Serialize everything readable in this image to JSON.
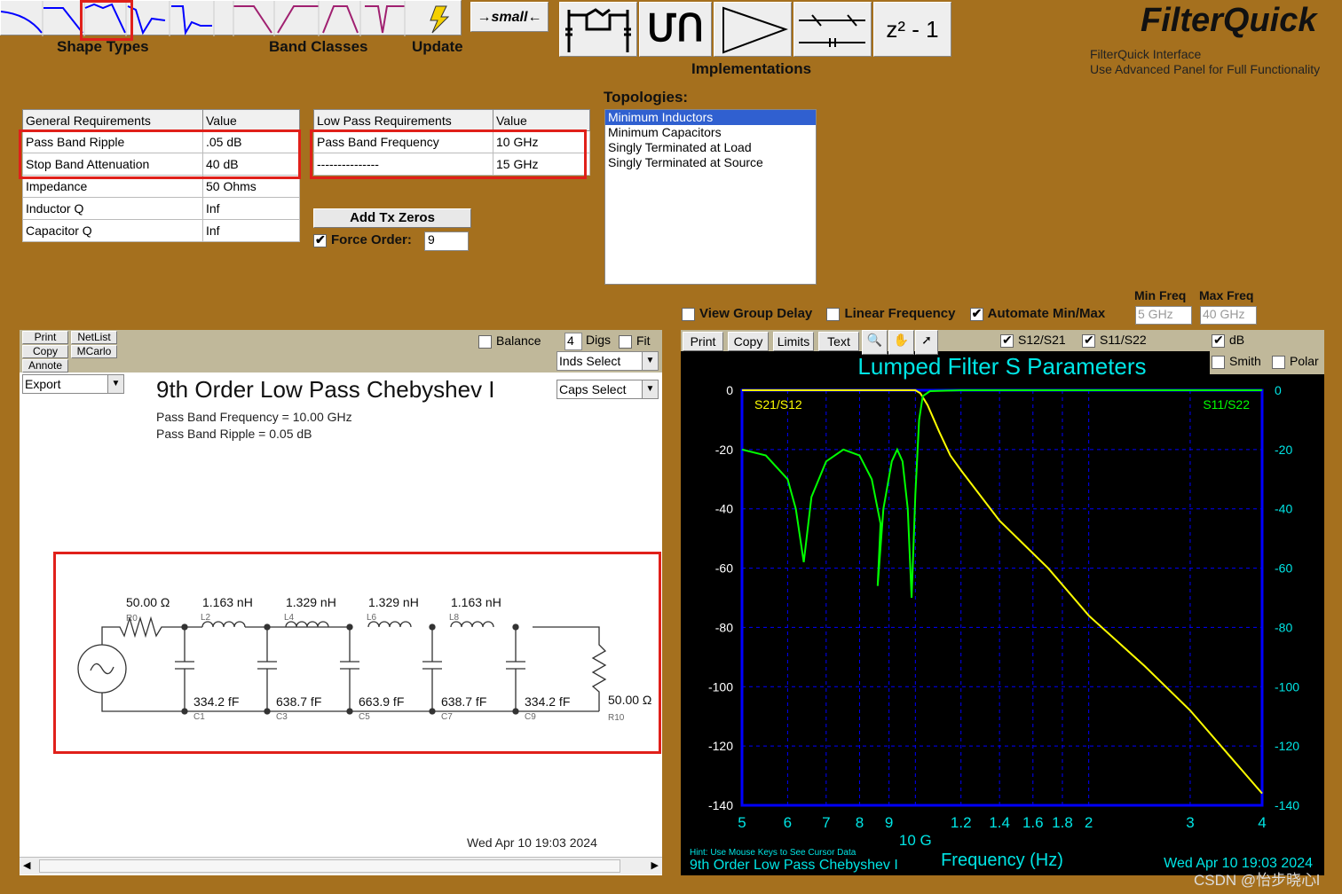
{
  "toolbar": {
    "shape_types_label": "Shape Types",
    "band_classes_label": "Band Classes",
    "update_label": "Update",
    "small_label": "small",
    "implementations_label": "Implementations",
    "z_label": "z² - 1"
  },
  "brand": {
    "title": "FilterQuick",
    "line1": "FilterQuick Interface",
    "line2": "Use Advanced Panel for Full  Functionality"
  },
  "general": {
    "headers": [
      "General Requirements",
      "Value"
    ],
    "rows": [
      [
        "Pass Band Ripple",
        ".05 dB"
      ],
      [
        "Stop Band Attenuation",
        "40 dB"
      ],
      [
        "Impedance",
        "50 Ohms"
      ],
      [
        "Inductor Q",
        "Inf"
      ],
      [
        "Capacitor Q",
        "Inf"
      ]
    ]
  },
  "lowpass": {
    "headers": [
      "Low Pass Requirements",
      "Value"
    ],
    "rows": [
      [
        "Pass Band Frequency",
        "10 GHz"
      ],
      [
        "---------------",
        "15 GHz"
      ]
    ]
  },
  "add_tx_zeros": "Add Tx Zeros",
  "force_order_label": "Force Order:",
  "force_order_value": "9",
  "force_order_checked": true,
  "topologies": {
    "label": "Topologies:",
    "items": [
      "Minimum Inductors",
      "Minimum Capacitors",
      "Singly Terminated at Load",
      "Singly Terminated at Source"
    ],
    "selected": 0
  },
  "options": {
    "view_group_delay": "View Group Delay",
    "linear_frequency": "Linear Frequency",
    "automate": "Automate Min/Max",
    "min_freq_label": "Min Freq",
    "max_freq_label": "Max Freq",
    "min_freq": "5 GHz",
    "max_freq": "40 GHz"
  },
  "schem": {
    "print": "Print",
    "copy": "Copy",
    "annote": "Annote",
    "netlist": "NetList",
    "mcarlo": "MCarlo",
    "export": "Export",
    "balance": "Balance",
    "digs_value": "4",
    "digs": "Digs",
    "fit": "Fit",
    "inds_select": "Inds Select",
    "caps_select": "Caps Select",
    "title": "9th Order Low Pass Chebyshev I",
    "line1": "Pass Band Frequency = 10.00 GHz",
    "line2": "Pass Band Ripple = 0.05 dB",
    "date": "Wed Apr 10 19:03 2024",
    "r0": {
      "value": "50.00 Ω",
      "name": "R0"
    },
    "r10": {
      "value": "50.00 Ω",
      "name": "R10"
    },
    "inductors": [
      {
        "value": "1.163 nH",
        "name": "L2"
      },
      {
        "value": "1.329 nH",
        "name": "L4"
      },
      {
        "value": "1.329 nH",
        "name": "L6"
      },
      {
        "value": "1.163 nH",
        "name": "L8"
      }
    ],
    "capacitors": [
      {
        "value": "334.2 fF",
        "name": "C1"
      },
      {
        "value": "638.7 fF",
        "name": "C3"
      },
      {
        "value": "663.9 fF",
        "name": "C5"
      },
      {
        "value": "638.7 fF",
        "name": "C7"
      },
      {
        "value": "334.2 fF",
        "name": "C9"
      }
    ]
  },
  "plot_toolbar": {
    "print": "Print",
    "copy": "Copy",
    "limits": "Limits",
    "text": "Text",
    "s12": "S12/S21",
    "s11": "S11/S22",
    "db": "dB",
    "smith": "Smith",
    "polar": "Polar"
  },
  "chart_data": {
    "type": "line",
    "title": "Lumped Filter S Parameters",
    "xlabel": "Frequency (Hz)",
    "ylabel": "",
    "x_scale": "log",
    "xlim": [
      5,
      40
    ],
    "ylim": [
      -140,
      0
    ],
    "grid": true,
    "x_ticks": [
      {
        "v": 5,
        "t": "5"
      },
      {
        "v": 6,
        "t": "6"
      },
      {
        "v": 7,
        "t": "7"
      },
      {
        "v": 8,
        "t": "8"
      },
      {
        "v": 9,
        "t": "9"
      },
      {
        "v": 12,
        "t": "1.2"
      },
      {
        "v": 14,
        "t": "1.4"
      },
      {
        "v": 16,
        "t": "1.6"
      },
      {
        "v": 18,
        "t": "1.8"
      },
      {
        "v": 20,
        "t": "2"
      },
      {
        "v": 30,
        "t": "3"
      },
      {
        "v": 40,
        "t": "4"
      }
    ],
    "x_decade_label": "10 G",
    "y_ticks": [
      0,
      -20,
      -40,
      -60,
      -80,
      -100,
      -120,
      -140
    ],
    "series": [
      {
        "name": "S21/S12",
        "color": "#ffff00",
        "x": [
          5,
          10,
          10.2,
          10.5,
          11,
          11.5,
          12,
          14,
          17,
          20,
          25,
          30,
          35,
          40
        ],
        "y": [
          0,
          0,
          -1,
          -5,
          -14,
          -22,
          -27,
          -44,
          -60,
          -76,
          -93,
          -108,
          -123,
          -136
        ]
      },
      {
        "name": "S11/S22",
        "color": "#00ff00",
        "x": [
          5,
          5.5,
          6,
          6.2,
          6.4,
          6.6,
          7,
          7.5,
          8,
          8.4,
          8.7,
          8.6,
          8.8,
          9.1,
          9.3,
          9.5,
          9.7,
          9.85,
          10,
          10.15,
          10.3,
          10.6,
          12,
          40
        ],
        "y": [
          -20,
          -22,
          -30,
          -40,
          -58,
          -36,
          -24,
          -20,
          -22,
          -30,
          -45,
          -66,
          -40,
          -24,
          -20,
          -24,
          -40,
          -70,
          -35,
          -10,
          -2,
          -0.3,
          0,
          0
        ]
      }
    ],
    "hint": "Hint: Use Mouse Keys to See Cursor Data",
    "footer_title": "9th Order Low Pass Chebyshev I",
    "date": "Wed Apr 10 19:03 2024"
  },
  "watermark": "CSDN @怡步晓心l"
}
